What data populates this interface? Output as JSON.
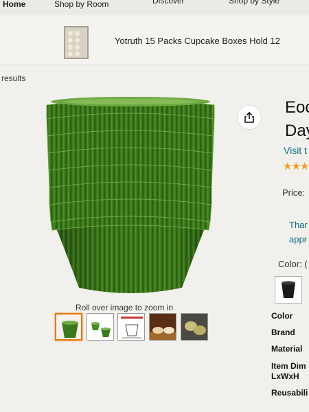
{
  "nav": {
    "home": "Home",
    "shop_by_room": "Shop by Room",
    "discover": "Discover",
    "shop_by_style": "Shop by Style"
  },
  "banner": {
    "title": "Yotruth 15 Packs Cupcake Boxes Hold 12"
  },
  "results_link": "results",
  "image": {
    "zoom_hint": "Roll over image to zoom in",
    "share_icon": "share-icon",
    "cup_color": "#3f7d1c",
    "thumbnails": [
      {
        "name": "thumbnail-green-cups",
        "selected": true
      },
      {
        "name": "thumbnail-cups-in-use",
        "selected": false
      },
      {
        "name": "thumbnail-size-chart",
        "selected": false
      },
      {
        "name": "thumbnail-baked-cupcakes",
        "selected": false
      },
      {
        "name": "thumbnail-filled-cups",
        "selected": false
      }
    ]
  },
  "product": {
    "title_line1": "Eoc",
    "title_line2": "Day",
    "visit_link": "Visit t",
    "rating_stars": "★★★",
    "price_label": "Price:",
    "note_line1": "Thar",
    "note_line2": "appr",
    "color_label": "Color: ("
  },
  "specs": [
    "Color",
    "Brand",
    "Material",
    "Item Dim",
    "LxWxH",
    "Reusabili"
  ],
  "colors": {
    "link": "#0a6f8a",
    "star": "#f09c17",
    "selected_border": "#e77600"
  }
}
